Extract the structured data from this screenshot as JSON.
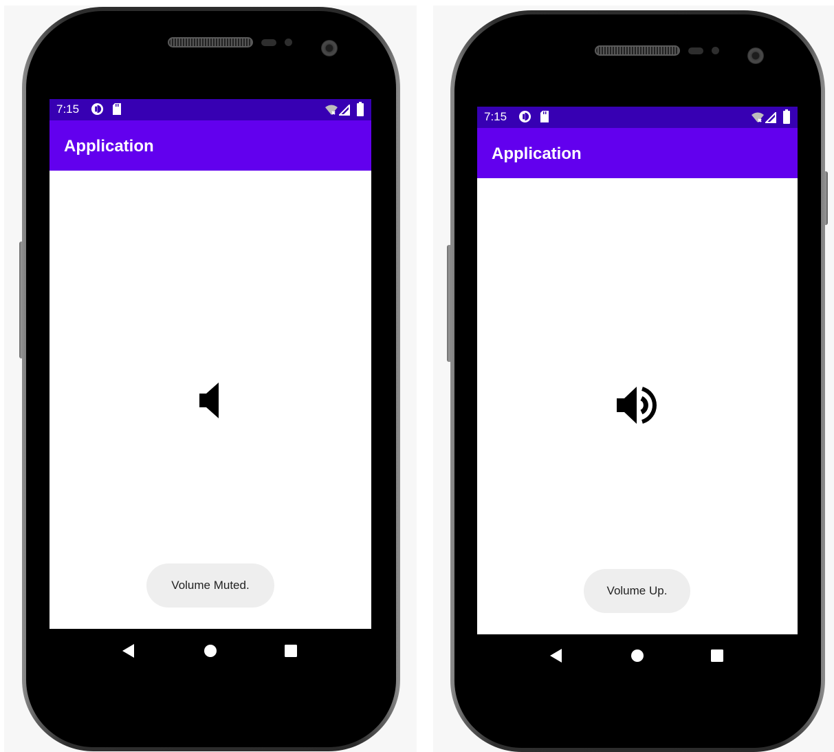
{
  "phones": [
    {
      "status_time": "7:15",
      "app_title": "Application",
      "volume_state_icon": "speaker-muted-icon",
      "toast": "Volume Muted."
    },
    {
      "status_time": "7:15",
      "app_title": "Application",
      "volume_state_icon": "speaker-volume-up-icon",
      "toast": "Volume Up."
    }
  ],
  "colors": {
    "status_bar": "#3700b3",
    "app_bar": "#6200ee",
    "toast_bg": "#eeeeee"
  }
}
